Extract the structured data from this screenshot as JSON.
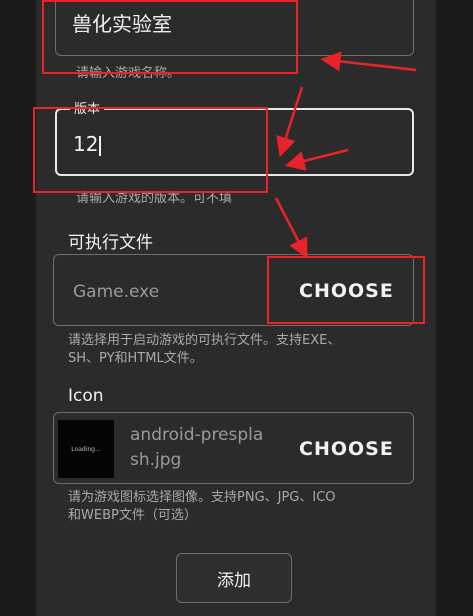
{
  "name_field": {
    "value": "兽化实验室",
    "hint": "请输入游戏名称。"
  },
  "version_field": {
    "label": "版本",
    "value": "12",
    "hint": "请输入游戏的版本。可不填"
  },
  "executable": {
    "label": "可执行文件",
    "value": "Game.exe",
    "choose_label": "CHOOSE",
    "hint_lines": [
      "请选择用于启动游戏的可执行文件。支持EXE、",
      "SH、PY和HTML文件。"
    ]
  },
  "icon": {
    "label": "Icon",
    "thumb_text": "Loading...",
    "file_lines": [
      "android-prespla",
      "sh.jpg"
    ],
    "choose_label": "CHOOSE",
    "hint_lines": [
      "请为游戏图标选择图像。支持PNG、JPG、ICO",
      "和WEBP文件（可选）"
    ]
  },
  "submit_label": "添加",
  "colors": {
    "annotation": "#e8232a",
    "panel": "#2b2b2b",
    "background": "#1b1b1b"
  }
}
